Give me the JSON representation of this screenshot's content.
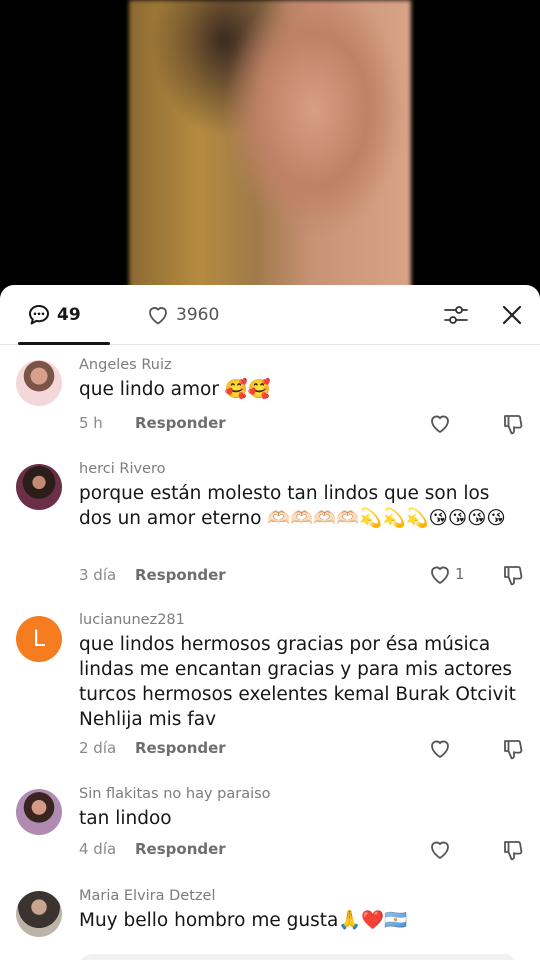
{
  "header": {
    "comment_count": "49",
    "like_count": "3960",
    "icons": [
      "comment-bubble-icon",
      "heart-icon",
      "filter-sliders-icon",
      "close-icon"
    ]
  },
  "comments": [
    {
      "username": "Angeles Ruiz",
      "text": "que lindo amor 🥰🥰",
      "time": "5 h",
      "reply_label": "Responder",
      "likes": ""
    },
    {
      "username": "herci Rivero",
      "text": "porque están molesto tan lindos que son los dos un amor eterno 🫶🏻🫶🏻🫶🏻🫶🏻💫💫💫😘😘😘😘",
      "time": "3 día",
      "reply_label": "Responder",
      "likes": "1"
    },
    {
      "username": "lucianunez281",
      "avatar_letter": "L",
      "text": "que lindos hermosos gracias por ésa música lindas me encantan gracias y para mis actores turcos hermosos exelentes kemal Burak Otcivit Nehlija mis fav",
      "time": "2 día",
      "reply_label": "Responder",
      "likes": ""
    },
    {
      "username": "Sin flakitas no hay paraiso",
      "text": "tan lindoo",
      "time": "4 día",
      "reply_label": "Responder",
      "likes": ""
    },
    {
      "username": "Maria Elvira Detzel",
      "text": "Muy bello hombro me gusta🙏❤️🇦🇷",
      "time": "",
      "reply_label": "",
      "likes": ""
    }
  ],
  "colors": {
    "text_primary": "#161616",
    "text_secondary": "#7c7c7c",
    "avatar_letter_bg": "#f57c1f"
  }
}
